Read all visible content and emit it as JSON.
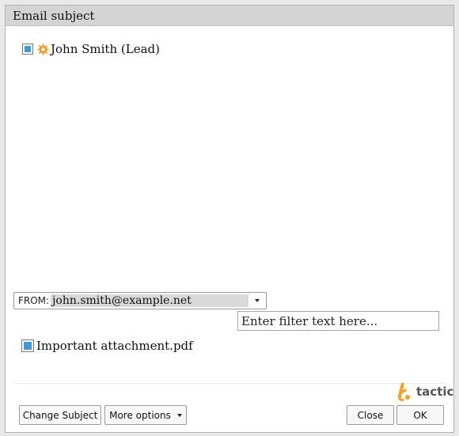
{
  "dialog": {
    "title": "Email subject"
  },
  "recipient": {
    "name": "John Smith (Lead)",
    "checked": true,
    "icon": "gear-icon"
  },
  "from": {
    "label": "FROM:",
    "value": "john.smith@example.net"
  },
  "filter": {
    "placeholder": "Enter filter text here..."
  },
  "attachment": {
    "name": "Important attachment.pdf",
    "checked": true
  },
  "logo": {
    "text": "tactic"
  },
  "buttons": {
    "change_subject": "Change Subject",
    "more_options": "More options",
    "close": "Close",
    "ok": "OK"
  },
  "colors": {
    "accent": "#3d9ad6",
    "logo_orange": "#f4a11c",
    "gear_orange": "#f09a1f"
  }
}
